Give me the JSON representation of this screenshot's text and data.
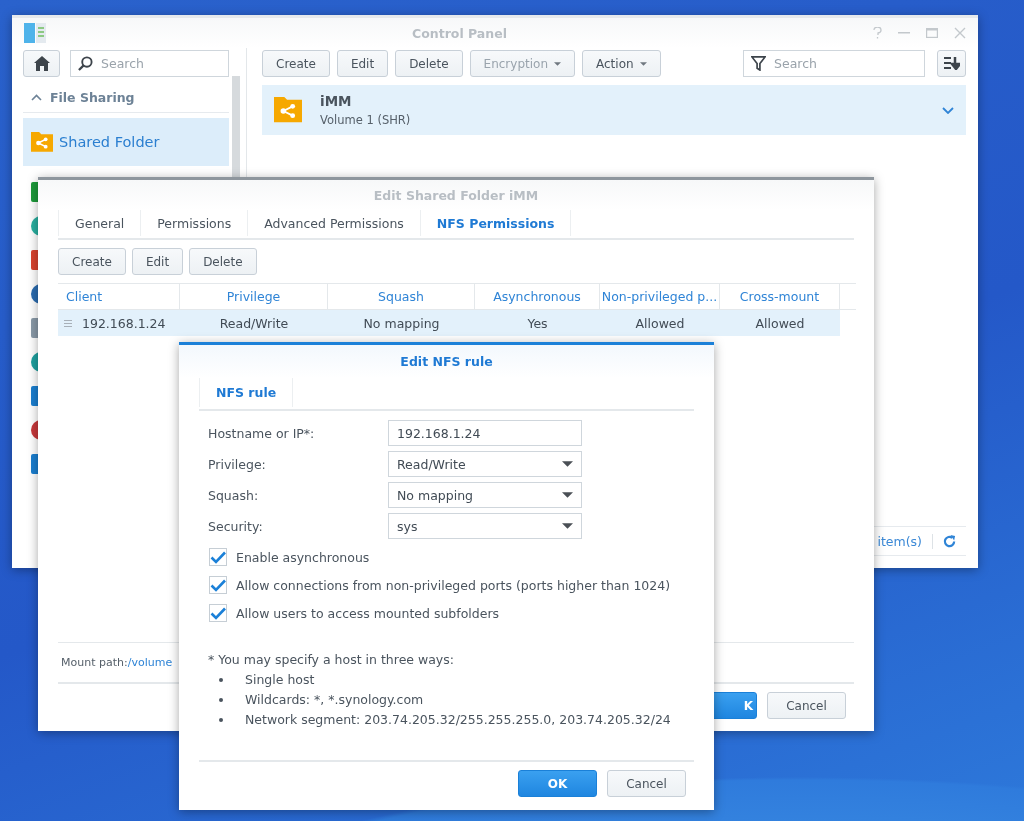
{
  "control_panel": {
    "title": "Control Panel",
    "search": {
      "placeholder": "Search"
    },
    "sidebar": {
      "section": {
        "label": "File Sharing",
        "expanded": true
      },
      "items": [
        {
          "label": "Shared Folder",
          "selected": true
        }
      ]
    },
    "toolbar": [
      {
        "label": "Create",
        "disabled": false,
        "dropdown": false
      },
      {
        "label": "Edit",
        "disabled": false,
        "dropdown": false
      },
      {
        "label": "Delete",
        "disabled": false,
        "dropdown": false
      },
      {
        "label": "Encryption",
        "disabled": true,
        "dropdown": true
      },
      {
        "label": "Action",
        "disabled": false,
        "dropdown": true
      }
    ],
    "filter": {
      "placeholder": "Search"
    },
    "folders": [
      {
        "name": "iMM",
        "volume": "Volume 1 (SHR)",
        "selected": true
      }
    ],
    "footer": {
      "count_label": "item(s)"
    }
  },
  "shared_folder_dialog": {
    "title": "Edit Shared Folder iMM",
    "tabs": [
      {
        "label": "General",
        "selected": false
      },
      {
        "label": "Permissions",
        "selected": false
      },
      {
        "label": "Advanced Permissions",
        "selected": false
      },
      {
        "label": "NFS Permissions",
        "selected": true
      }
    ],
    "buttons": [
      "Create",
      "Edit",
      "Delete"
    ],
    "table": {
      "columns": [
        "Client",
        "Privilege",
        "Squash",
        "Asynchronous",
        "Non-privileged p...",
        "Cross-mount"
      ],
      "rows": [
        {
          "cells": [
            "192.168.1.24",
            "Read/Write",
            "No mapping",
            "Yes",
            "Allowed",
            "Allowed"
          ],
          "selected": true
        }
      ]
    },
    "mount_path": {
      "label": "Mount path:",
      "link": "/volume"
    },
    "footer_buttons": [
      {
        "label": "K",
        "kind": "primary"
      },
      {
        "label": "Cancel",
        "kind": "secondary"
      }
    ]
  },
  "nfs_dialog": {
    "title": "Edit NFS rule",
    "tabs": [
      {
        "label": "NFS rule",
        "selected": true
      }
    ],
    "fields": [
      {
        "label": "Hostname or IP*:",
        "kind": "text",
        "value": "192.168.1.24"
      },
      {
        "label": "Privilege:",
        "kind": "select",
        "value": "Read/Write"
      },
      {
        "label": "Squash:",
        "kind": "select",
        "value": "No mapping"
      },
      {
        "label": "Security:",
        "kind": "select",
        "value": "sys"
      }
    ],
    "options": [
      {
        "label": "Enable asynchronous",
        "checked": true
      },
      {
        "label": "Allow connections from non-privileged ports (ports higher than 1024)",
        "checked": true
      },
      {
        "label": "Allow users to access mounted subfolders",
        "checked": true
      }
    ],
    "note": {
      "intro": "* You may specify a host in three ways:",
      "items": [
        "Single host",
        "Wildcards: *, *.synology.com",
        "Network segment: 203.74.205.32/255.255.255.0, 203.74.205.32/24"
      ]
    },
    "footer_buttons": [
      {
        "label": "OK",
        "kind": "primary"
      },
      {
        "label": "Cancel",
        "kind": "secondary"
      }
    ]
  }
}
